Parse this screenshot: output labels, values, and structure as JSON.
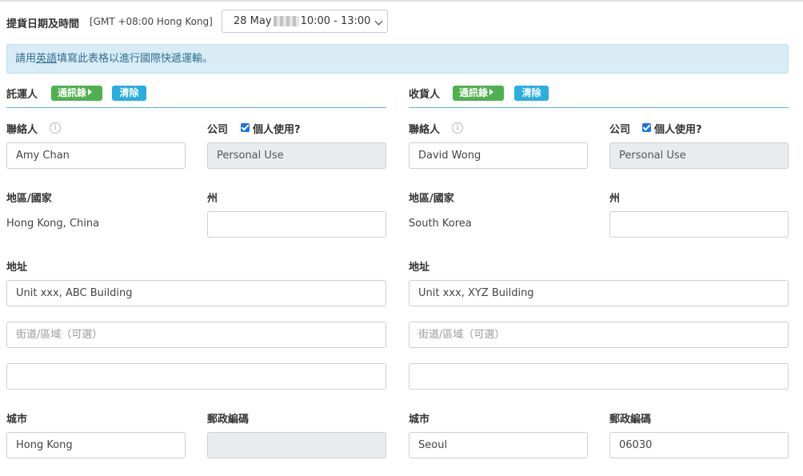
{
  "pickup": {
    "label": "提貨日期及時間",
    "timezone": "[GMT +08:00 Hong Kong]",
    "date_text": "28 May",
    "time_text": "10:00 - 13:00"
  },
  "notice": {
    "prefix": "請用",
    "highlight": "英語",
    "suffix": "填寫此表格以進行國際快遞運輸。"
  },
  "labels": {
    "contact": "聯絡人",
    "company": "公司",
    "personal_use": "個人使用?",
    "region": "地區/國家",
    "state": "州",
    "address": "地址",
    "city": "城市",
    "postcode": "郵政編碼",
    "address_book_btn": "通訊錄",
    "clear_btn": "清除",
    "street_placeholder": "街道/區域（可選）"
  },
  "shipper": {
    "title": "託運人",
    "contact": "Amy Chan",
    "company": "Personal Use",
    "region": "Hong Kong, China",
    "state": "",
    "address1": "Unit xxx, ABC Building",
    "address2": "",
    "address3": "",
    "city": "Hong Kong",
    "postcode": ""
  },
  "consignee": {
    "title": "收貨人",
    "contact": "David Wong",
    "company": "Personal Use",
    "region": "South Korea",
    "state": "",
    "address1": "Unit xxx, XYZ Building",
    "address2": "",
    "address3": "",
    "city": "Seoul",
    "postcode": "06030"
  },
  "colors": {
    "green_button": "#4fb04f",
    "blue_button": "#29aee0",
    "notice_bg": "#d9ecf6",
    "section_rule": "#5db5d6"
  }
}
